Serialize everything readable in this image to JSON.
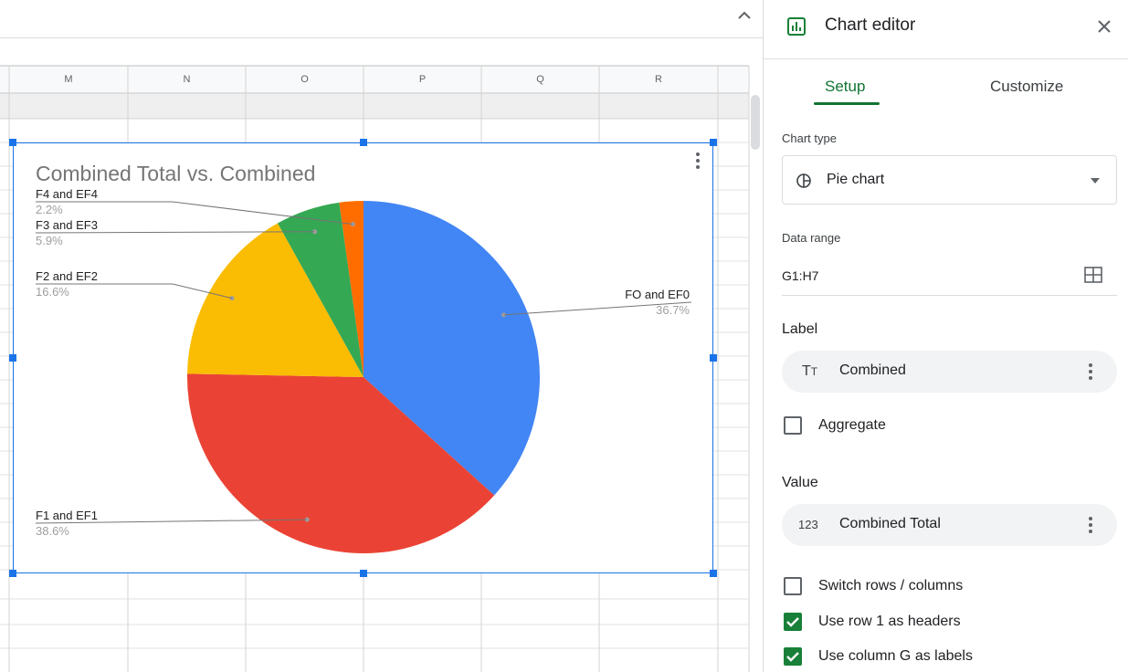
{
  "sheet": {
    "columns": [
      "M",
      "N",
      "O",
      "P",
      "Q",
      "R"
    ],
    "chart": {
      "chart_data": {
        "type": "pie",
        "title": "Combined Total vs. Combined",
        "slices": [
          {
            "label": "FO and EF0",
            "percent": 36.7,
            "percent_text": "36.7%",
            "color": "#4285f4"
          },
          {
            "label": "F1 and EF1",
            "percent": 38.6,
            "percent_text": "38.6%",
            "color": "#ea4335"
          },
          {
            "label": "F2 and EF2",
            "percent": 16.6,
            "percent_text": "16.6%",
            "color": "#fbbc04"
          },
          {
            "label": "F3 and EF3",
            "percent": 5.9,
            "percent_text": "5.9%",
            "color": "#34a853"
          },
          {
            "label": "F4 and EF4",
            "percent": 2.2,
            "percent_text": "2.2%",
            "color": "#ff6d01"
          }
        ],
        "legend": "labeled"
      }
    }
  },
  "editor": {
    "title": "Chart editor",
    "tabs": [
      {
        "label": "Setup",
        "active": true
      },
      {
        "label": "Customize",
        "active": false
      }
    ],
    "chart_type": {
      "heading": "Chart type",
      "value": "Pie chart"
    },
    "data_range": {
      "heading": "Data range",
      "value": "G1:H7"
    },
    "label": {
      "heading": "Label",
      "value": "Combined",
      "icon": "text-type-icon"
    },
    "aggregate": {
      "label": "Aggregate",
      "checked": false
    },
    "value": {
      "heading": "Value",
      "value": "Combined Total",
      "icon": "number-icon"
    },
    "options": [
      {
        "label": "Switch rows / columns",
        "checked": false
      },
      {
        "label": "Use row 1 as headers",
        "checked": true
      },
      {
        "label": "Use column G as labels",
        "checked": true
      }
    ]
  },
  "colors": {
    "accent_green": "#137333",
    "selection_blue": "#1a73e8"
  }
}
